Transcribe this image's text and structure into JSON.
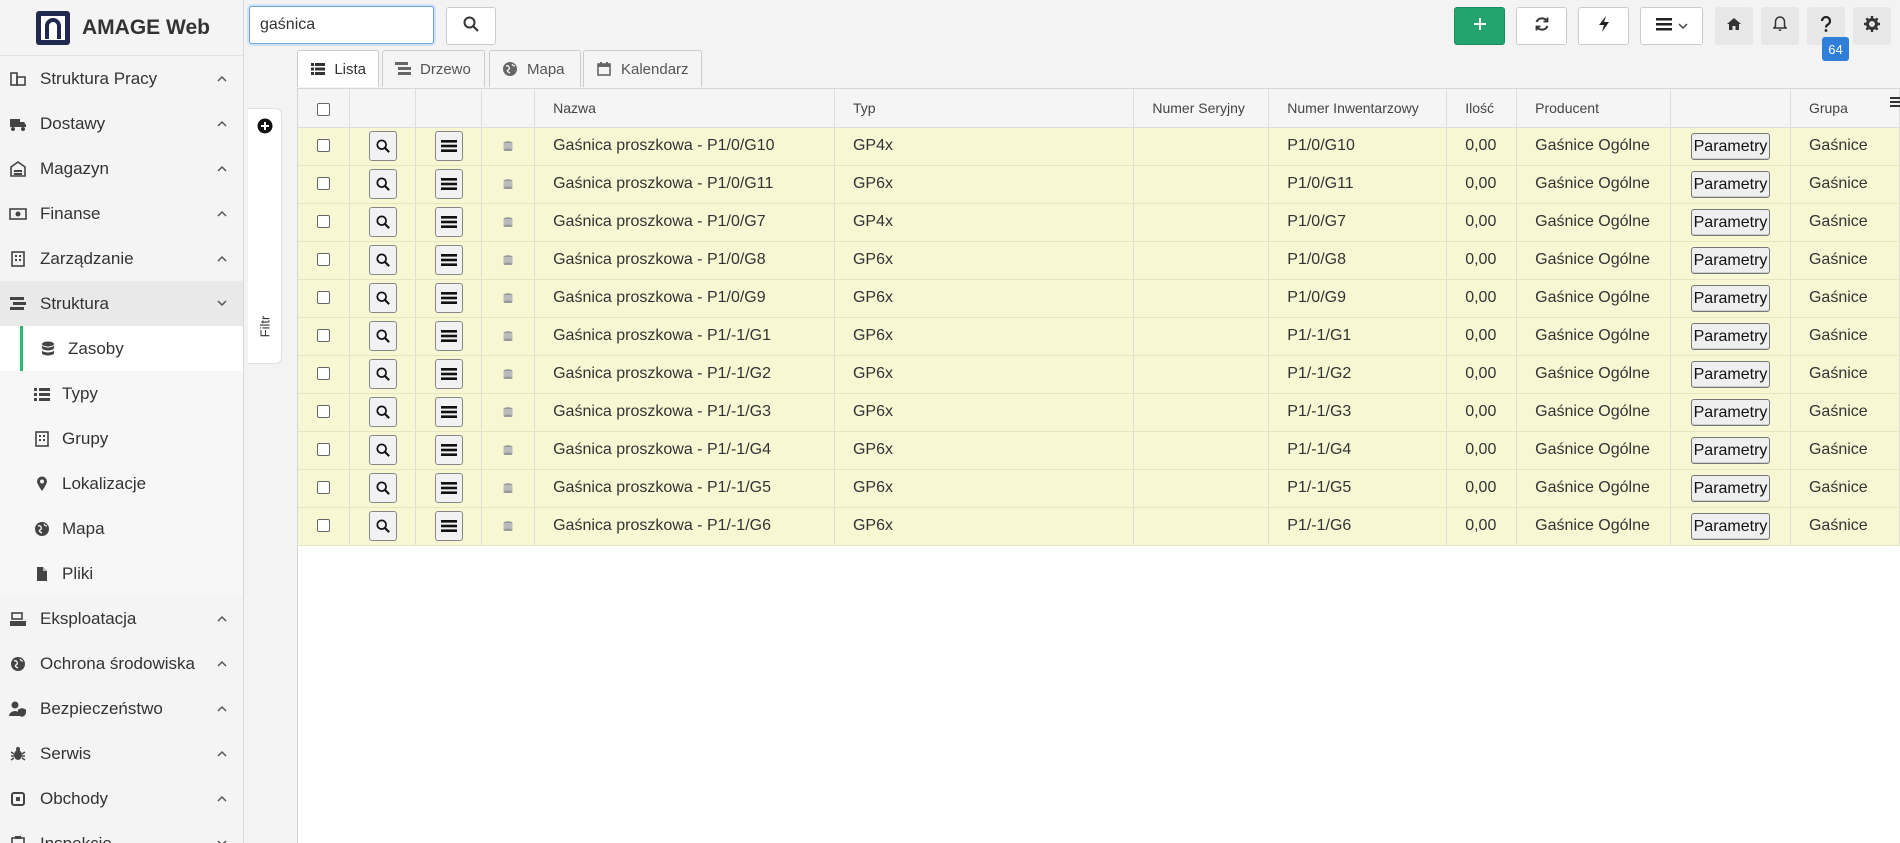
{
  "app": {
    "title": "AMAGE Web"
  },
  "sidebar": {
    "items": [
      {
        "label": "Struktura Pracy",
        "icon": "sitemap-icon"
      },
      {
        "label": "Dostawy",
        "icon": "truck-icon"
      },
      {
        "label": "Magazyn",
        "icon": "warehouse-icon"
      },
      {
        "label": "Finanse",
        "icon": "money-icon"
      },
      {
        "label": "Zarządzanie",
        "icon": "building-icon"
      },
      {
        "label": "Struktura",
        "icon": "stream-icon"
      }
    ],
    "subitems": [
      {
        "label": "Zasoby",
        "icon": "database-icon"
      },
      {
        "label": "Typy",
        "icon": "list-icon"
      },
      {
        "label": "Grupy",
        "icon": "building-icon"
      },
      {
        "label": "Lokalizacje",
        "icon": "map-marker-icon"
      },
      {
        "label": "Mapa",
        "icon": "globe-icon"
      },
      {
        "label": "Pliki",
        "icon": "file-icon"
      }
    ],
    "items_after": [
      {
        "label": "Eksploatacja",
        "icon": "tools-icon"
      },
      {
        "label": "Ochrona środowiska",
        "icon": "globe-icon"
      },
      {
        "label": "Bezpieczeństwo",
        "icon": "user-shield-icon"
      },
      {
        "label": "Serwis",
        "icon": "bug-icon"
      },
      {
        "label": "Obchody",
        "icon": "route-icon"
      },
      {
        "label": "Inspekcje",
        "icon": "clipboard-icon"
      }
    ]
  },
  "filter": {
    "label": "Filtr"
  },
  "search": {
    "value": "gaśnica",
    "placeholder": ""
  },
  "toolbar": {
    "notification_count": "64"
  },
  "tabs": [
    {
      "label": "Lista",
      "icon": "list-icon"
    },
    {
      "label": "Drzewo",
      "icon": "tree-icon"
    },
    {
      "label": "Mapa",
      "icon": "globe-icon"
    },
    {
      "label": "Kalendarz",
      "icon": "calendar-icon"
    }
  ],
  "table": {
    "columns": [
      "Nazwa",
      "Typ",
      "Numer Seryjny",
      "Numer Inwentarzowy",
      "Ilość",
      "Producent",
      "",
      "Grupa"
    ],
    "param_label": "Parametry",
    "rows": [
      {
        "name": "Gaśnica proszkowa - P1/0/G10",
        "type": "GP4x",
        "serial": "",
        "inventory": "P1/0/G10",
        "qty": "0,00",
        "producer": "Gaśnice Ogólne",
        "group": "Gaśnice"
      },
      {
        "name": "Gaśnica proszkowa - P1/0/G11",
        "type": "GP6x",
        "serial": "",
        "inventory": "P1/0/G11",
        "qty": "0,00",
        "producer": "Gaśnice Ogólne",
        "group": "Gaśnice"
      },
      {
        "name": "Gaśnica proszkowa - P1/0/G7",
        "type": "GP4x",
        "serial": "",
        "inventory": "P1/0/G7",
        "qty": "0,00",
        "producer": "Gaśnice Ogólne",
        "group": "Gaśnice"
      },
      {
        "name": "Gaśnica proszkowa - P1/0/G8",
        "type": "GP6x",
        "serial": "",
        "inventory": "P1/0/G8",
        "qty": "0,00",
        "producer": "Gaśnice Ogólne",
        "group": "Gaśnice"
      },
      {
        "name": "Gaśnica proszkowa - P1/0/G9",
        "type": "GP6x",
        "serial": "",
        "inventory": "P1/0/G9",
        "qty": "0,00",
        "producer": "Gaśnice Ogólne",
        "group": "Gaśnice"
      },
      {
        "name": "Gaśnica proszkowa - P1/-1/G1",
        "type": "GP6x",
        "serial": "",
        "inventory": "P1/-1/G1",
        "qty": "0,00",
        "producer": "Gaśnice Ogólne",
        "group": "Gaśnice"
      },
      {
        "name": "Gaśnica proszkowa - P1/-1/G2",
        "type": "GP6x",
        "serial": "",
        "inventory": "P1/-1/G2",
        "qty": "0,00",
        "producer": "Gaśnice Ogólne",
        "group": "Gaśnice"
      },
      {
        "name": "Gaśnica proszkowa - P1/-1/G3",
        "type": "GP6x",
        "serial": "",
        "inventory": "P1/-1/G3",
        "qty": "0,00",
        "producer": "Gaśnice Ogólne",
        "group": "Gaśnice"
      },
      {
        "name": "Gaśnica proszkowa - P1/-1/G4",
        "type": "GP6x",
        "serial": "",
        "inventory": "P1/-1/G4",
        "qty": "0,00",
        "producer": "Gaśnice Ogólne",
        "group": "Gaśnice"
      },
      {
        "name": "Gaśnica proszkowa - P1/-1/G5",
        "type": "GP6x",
        "serial": "",
        "inventory": "P1/-1/G5",
        "qty": "0,00",
        "producer": "Gaśnice Ogólne",
        "group": "Gaśnice"
      },
      {
        "name": "Gaśnica proszkowa - P1/-1/G6",
        "type": "GP6x",
        "serial": "",
        "inventory": "P1/-1/G6",
        "qty": "0,00",
        "producer": "Gaśnice Ogólne",
        "group": "Gaśnice"
      }
    ]
  },
  "colors": {
    "accent_green": "#23a36e",
    "row_highlight": "#f7f7d4",
    "badge_blue": "#2f7ed8",
    "active_bar": "#2eb872"
  }
}
